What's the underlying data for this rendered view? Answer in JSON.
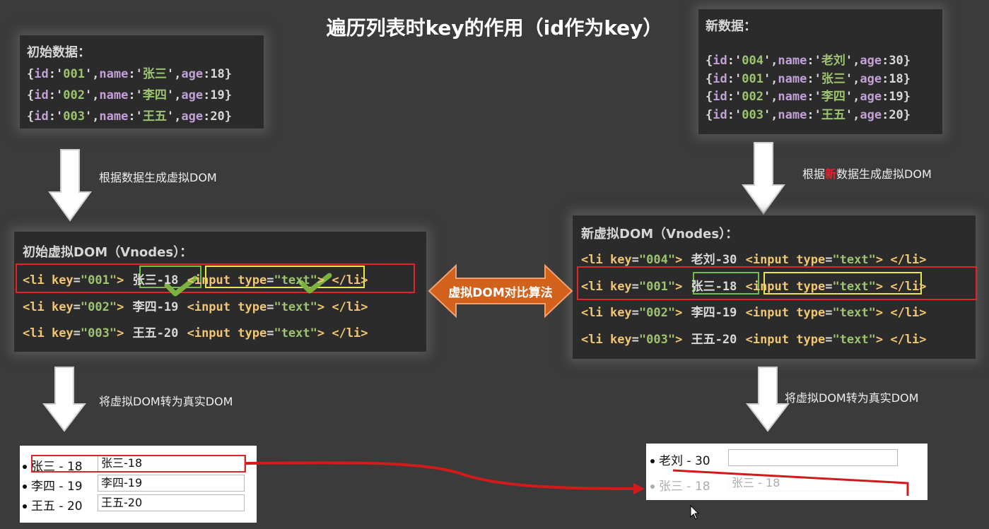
{
  "title": "遍历列表时key的作用（id作为key）",
  "initial_data": {
    "heading": "初始数据：",
    "rows": [
      {
        "id": "001",
        "name": "张三",
        "age": "18"
      },
      {
        "id": "002",
        "name": "李四",
        "age": "19"
      },
      {
        "id": "003",
        "name": "王五",
        "age": "20"
      }
    ]
  },
  "new_data": {
    "heading": "新数据：",
    "rows": [
      {
        "id": "004",
        "name": "老刘",
        "age": "30"
      },
      {
        "id": "001",
        "name": "张三",
        "age": "18"
      },
      {
        "id": "002",
        "name": "李四",
        "age": "19"
      },
      {
        "id": "003",
        "name": "王五",
        "age": "20"
      }
    ]
  },
  "labels": {
    "gen_initial": "根据数据生成虚拟DOM",
    "gen_new_prefix": "根据",
    "gen_new_highlight": "新",
    "gen_new_suffix": "数据生成虚拟DOM",
    "to_real_left": "将虚拟DOM转为真实DOM",
    "to_real_right": "将虚拟DOM转为真实DOM",
    "diff": "虚拟DOM对比算法"
  },
  "initial_vdom": {
    "heading": "初始虚拟DOM（Vnodes）：",
    "items": [
      {
        "key": "001",
        "text": "张三-18"
      },
      {
        "key": "002",
        "text": "李四-19"
      },
      {
        "key": "003",
        "text": "王五-20"
      }
    ]
  },
  "new_vdom": {
    "heading": "新虚拟DOM（Vnodes）：",
    "items": [
      {
        "key": "004",
        "text": "老刘-30"
      },
      {
        "key": "001",
        "text": "张三-18"
      },
      {
        "key": "002",
        "text": "李四-19"
      },
      {
        "key": "003",
        "text": "王五-20"
      }
    ]
  },
  "left_real": [
    {
      "label": "张三 - 18",
      "value": "张三-18"
    },
    {
      "label": "李四 - 19",
      "value": "李四-19"
    },
    {
      "label": "王五 - 20",
      "value": "王五-20"
    }
  ],
  "right_real": [
    {
      "label": "老刘 - 30",
      "value": ""
    },
    {
      "label": "张三 - 18",
      "value": "张三 - 18"
    }
  ],
  "colors": {
    "highlight_red": "#e0252a",
    "highlight_green": "#6fbf4a",
    "highlight_yellow": "#e8e84a",
    "diff_arrow": "#d2611b"
  }
}
